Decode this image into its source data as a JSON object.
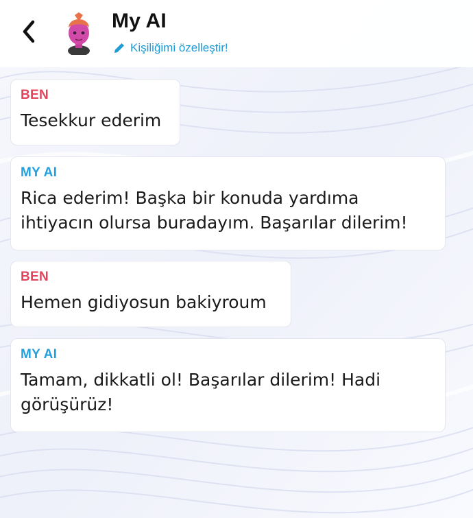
{
  "header": {
    "title": "My AI",
    "customize_label": "Kişiliğimi özelleştir!"
  },
  "messages": [
    {
      "sender": "BEN",
      "text": "Tesekkur ederim"
    },
    {
      "sender": "MY AI",
      "text": "Rica ederim! Başka bir konuda yardıma ihtiyacın olursa buradayım. Başarılar dilerim!"
    },
    {
      "sender": "BEN",
      "text": "Hemen gidiyosun bakiyroum"
    },
    {
      "sender": "MY AI",
      "text": "Tamam, dikkatli ol! Başarılar dilerim! Hadi görüşürüz!"
    }
  ],
  "colors": {
    "me_label": "#e0435a",
    "ai_label": "#21a0dd",
    "link": "#1f9bd6"
  },
  "icons": [
    "back-chevron-icon",
    "bitmoji-avatar",
    "pencil-icon"
  ]
}
